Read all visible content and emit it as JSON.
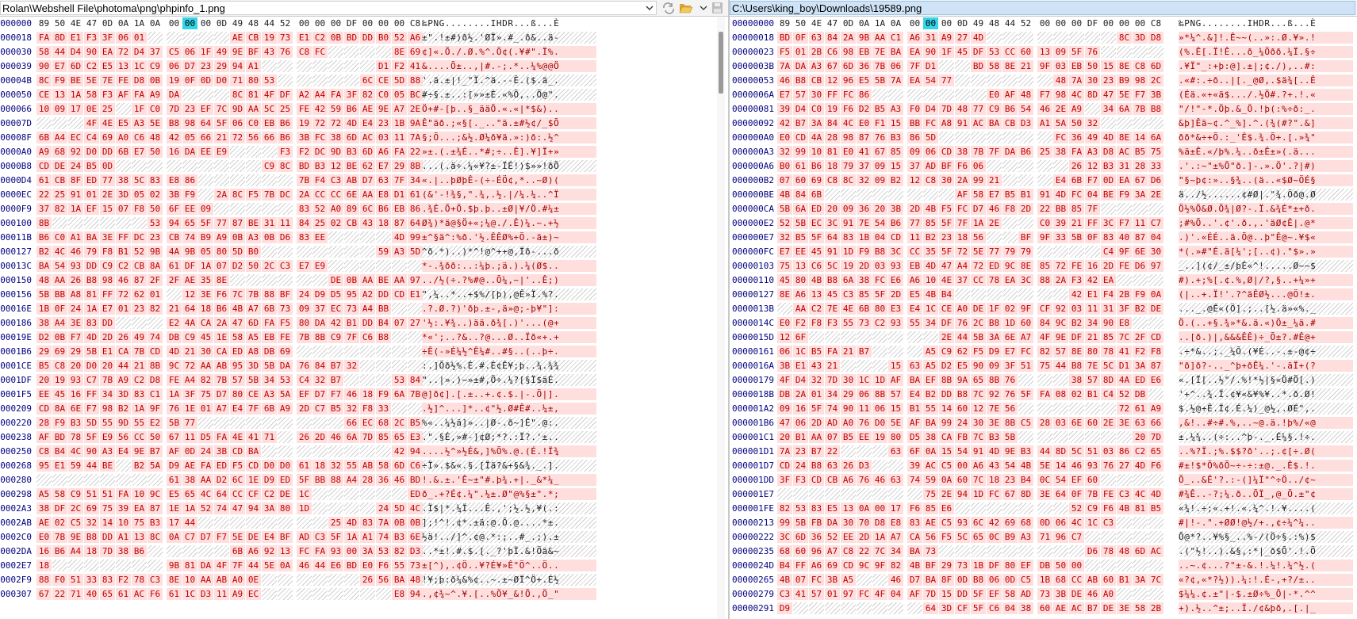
{
  "left_pane": {
    "path": "Rolan\\Webshell File\\photoma\\png\\phpinfo_1.png",
    "offsets": [
      "000000",
      "000018",
      "000030",
      "000039",
      "00004B",
      "000050",
      "000066",
      "00007D",
      "00008F",
      "0000A0",
      "0000B8",
      "0000D4",
      "0000EC",
      "0000F9",
      "000100",
      "00011B",
      "000127",
      "00013C",
      "000150",
      "000156",
      "00016E",
      "000186",
      "00019E",
      "0001B6",
      "0001CE",
      "0001DF",
      "0001F5",
      "000209",
      "000220",
      "000238",
      "000250",
      "000268",
      "000280",
      "000298",
      "0002A3",
      "0002AB",
      "0002C0",
      "0002DA",
      "0002E7",
      "0002F9",
      "000307"
    ],
    "first_row": [
      "89",
      "50",
      "4E",
      "47",
      "0D",
      "0A",
      "1A",
      "0A",
      "00",
      "00",
      "00",
      "0D",
      "49",
      "48",
      "44",
      "52",
      "00",
      "00",
      "00",
      "DF",
      "00",
      "00",
      "00",
      "C8"
    ],
    "ascii_first": "‰PNG........IHDR...ß...È"
  },
  "right_pane": {
    "path": "C:\\Users\\king_boy\\Downloads\\19589.png",
    "offsets": [
      "00000000",
      "00000018",
      "00000023",
      "0000003B",
      "00000053",
      "0000006A",
      "00000081",
      "00000092",
      "000000A0",
      "000000A3",
      "000000A6",
      "000000B2",
      "000000BE",
      "000000CA",
      "000000E2",
      "000000E7",
      "000000FC",
      "00000103",
      "00000110",
      "00000127",
      "0000013B",
      "0000014C",
      "0000015D",
      "00000161",
      "0000016A",
      "00000179",
      "0000018B",
      "000001A2",
      "000001B6",
      "000001C1",
      "000001D1",
      "000001D7",
      "000001DD",
      "000001E7",
      "000001FE",
      "00000213",
      "00000222",
      "00000235",
      "0000024D",
      "00000265",
      "00000279",
      "00000291"
    ],
    "first_row": [
      "89",
      "50",
      "4E",
      "47",
      "0D",
      "0A",
      "1A",
      "0A",
      "00",
      "00",
      "00",
      "0D",
      "49",
      "48",
      "44",
      "52",
      "00",
      "00",
      "00",
      "DF",
      "00",
      "00",
      "00",
      "C8"
    ],
    "ascii_first": "‰PNG........IHDR...ß...È"
  },
  "icons": {
    "dropdown": "chevron-down-icon",
    "sync": "sync-icon",
    "open": "folder-open-icon",
    "save": "save-icon"
  },
  "colors": {
    "diff_bg": "#ffdede",
    "diff_text": "#c00000",
    "cursor": "#33d6e8",
    "offset_text": "#000080",
    "active_path_bg": "#cfe3f7"
  }
}
